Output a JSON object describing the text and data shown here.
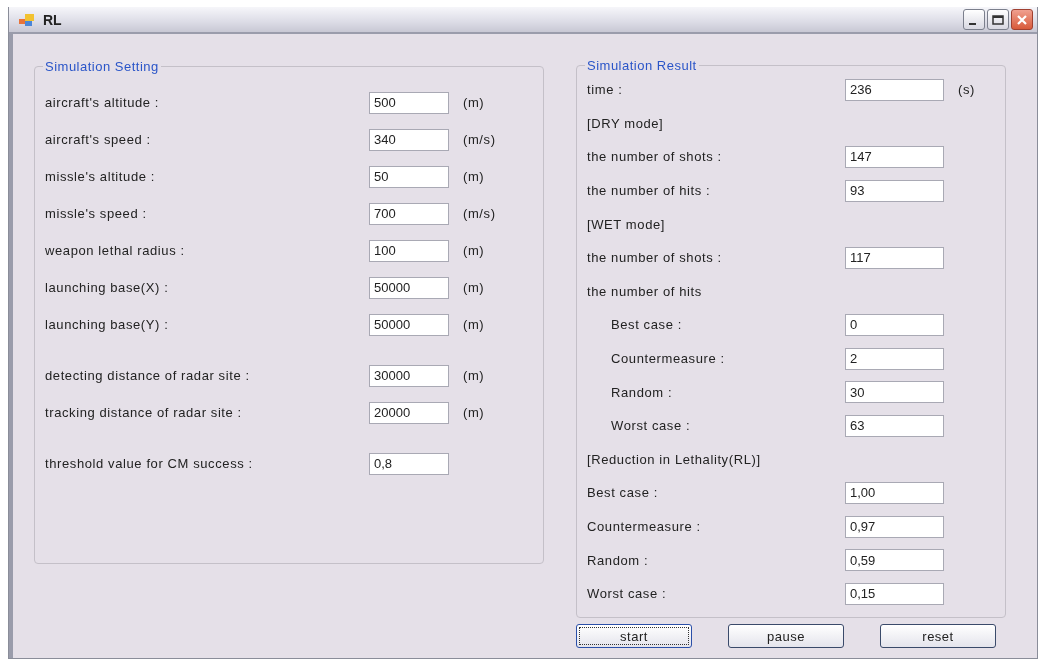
{
  "window": {
    "title": "RL"
  },
  "settings": {
    "title": "Simulation Setting",
    "groups": [
      [
        {
          "label": "aircraft's altitude :",
          "value": "500",
          "unit": "(m)"
        },
        {
          "label": "aircraft's speed :",
          "value": "340",
          "unit": "(m/s)"
        },
        {
          "label": "missle's altitude :",
          "value": "50",
          "unit": "(m)"
        },
        {
          "label": "missle's speed :",
          "value": "700",
          "unit": "(m/s)"
        },
        {
          "label": "weapon lethal radius :",
          "value": "100",
          "unit": "(m)"
        },
        {
          "label": "launching base(X) :",
          "value": "50000",
          "unit": "(m)"
        },
        {
          "label": "launching base(Y) :",
          "value": "50000",
          "unit": "(m)"
        }
      ],
      [
        {
          "label": "detecting distance of radar site :",
          "value": "30000",
          "unit": "(m)"
        },
        {
          "label": "tracking distance of radar site :",
          "value": "20000",
          "unit": "(m)"
        }
      ],
      [
        {
          "label": "threshold value for CM success :",
          "value": "0,8"
        }
      ]
    ]
  },
  "result": {
    "title": "Simulation Result",
    "items": [
      {
        "kind": "field",
        "label": "time :",
        "value": "236",
        "unit": "(s)"
      },
      {
        "kind": "heading",
        "label": "[DRY mode]"
      },
      {
        "kind": "field",
        "label": "the number of shots :",
        "value": "147"
      },
      {
        "kind": "field",
        "label": "the number of hits :",
        "value": "93"
      },
      {
        "kind": "heading",
        "label": "[WET mode]"
      },
      {
        "kind": "field",
        "label": "the number of shots :",
        "value": "117"
      },
      {
        "kind": "heading",
        "label": "the number of hits",
        "children": [
          {
            "kind": "field",
            "label": "Best case :",
            "value": "0"
          },
          {
            "kind": "field",
            "label": "Countermeasure :",
            "value": "2"
          },
          {
            "kind": "field",
            "label": "Random :",
            "value": "30"
          },
          {
            "kind": "field",
            "label": "Worst case :",
            "value": "63"
          }
        ]
      },
      {
        "kind": "heading",
        "label": "[Reduction in Lethality(RL)]"
      },
      {
        "kind": "field",
        "label": "Best case :",
        "value": "1,00"
      },
      {
        "kind": "field",
        "label": "Countermeasure :",
        "value": "0,97"
      },
      {
        "kind": "field",
        "label": "Random :",
        "value": "0,59"
      },
      {
        "kind": "field",
        "label": "Worst case :",
        "value": "0,15"
      }
    ]
  },
  "buttons": [
    {
      "label": "start",
      "focused": true
    },
    {
      "label": "pause",
      "focused": false
    },
    {
      "label": "reset",
      "focused": false
    }
  ]
}
